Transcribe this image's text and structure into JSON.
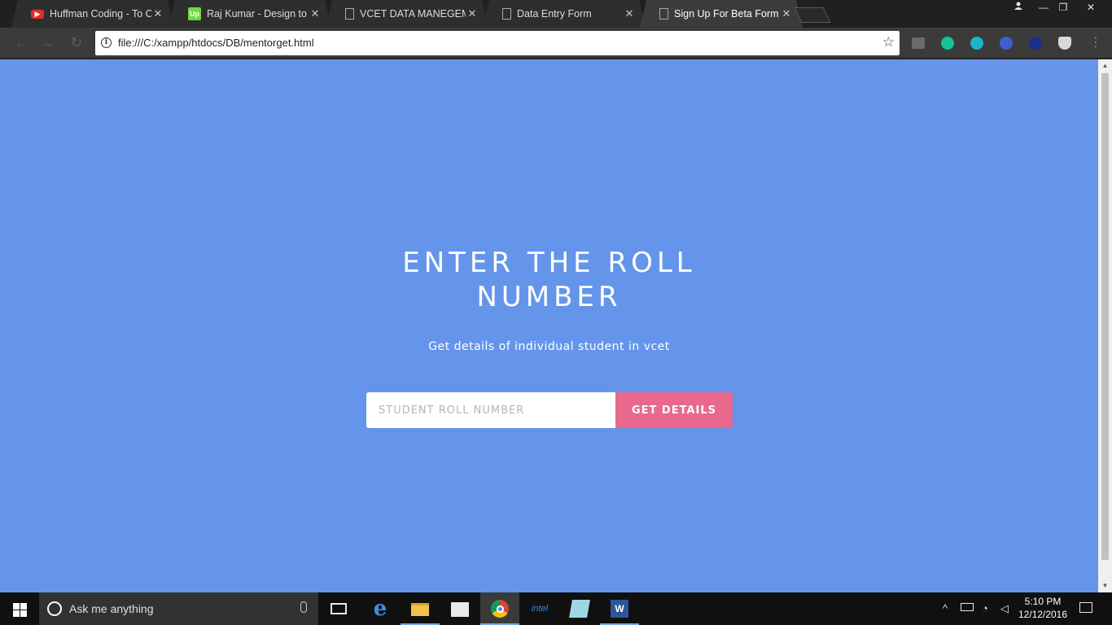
{
  "browser": {
    "tabs": [
      {
        "title": "Huffman Coding - To Ca",
        "favicon": "youtube-icon",
        "active": false
      },
      {
        "title": "Raj Kumar - Design to m",
        "favicon": "upwork-icon",
        "active": false
      },
      {
        "title": "VCET DATA MANEGEME",
        "favicon": "document-icon",
        "active": false
      },
      {
        "title": "Data Entry Form",
        "favicon": "document-icon",
        "active": false
      },
      {
        "title": "Sign Up For Beta Form",
        "favicon": "document-icon",
        "active": true
      }
    ],
    "url": "file:///C:/xampp/htdocs/DB/mentorget.html"
  },
  "page": {
    "headline_line1": "ENTER THE ROLL",
    "headline_line2": "NUMBER",
    "subtitle": "Get details of individual student in vcet",
    "input_placeholder": "STUDENT ROLL NUMBER",
    "button_label": "GET DETAILS",
    "colors": {
      "background": "#6495ea",
      "button": "#e8698c",
      "text": "#ffffff"
    }
  },
  "taskbar": {
    "search_placeholder": "Ask me anything",
    "time": "5:10 PM",
    "date": "12/12/2016"
  }
}
